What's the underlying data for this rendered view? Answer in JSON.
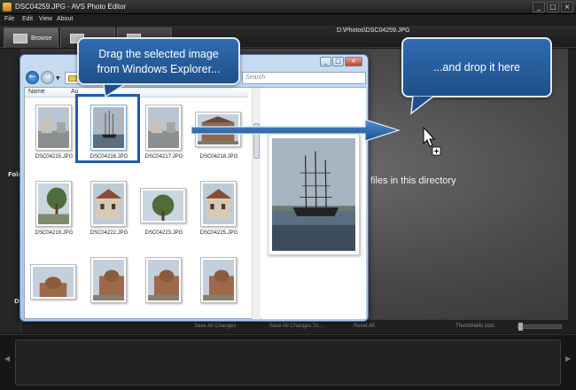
{
  "window": {
    "title": "DSC04259.JPG - AVS Photo Editor",
    "controls": [
      "_",
      "□",
      "×"
    ]
  },
  "menu": [
    "File",
    "Edit",
    "View",
    "About"
  ],
  "tabs": [
    {
      "label": "Browse",
      "active": true
    },
    {
      "label": "",
      "active": false
    },
    {
      "label": "",
      "active": false
    }
  ],
  "path": "D:\\Photos\\DSC04259.JPG",
  "left_panel": {
    "folders_label": "Fold",
    "bottom_label": "D"
  },
  "content": {
    "files_text": "files in this directory"
  },
  "status_bar": {
    "save_all": "Save All Changes",
    "save_all_to": "Save All Changes To...",
    "reset_all": "Reset All",
    "thumbnails_size": "Thumbnails size:",
    "thumbnails_size_level": 0
  },
  "explorer": {
    "address": "«",
    "search_placeholder": "Search",
    "columns": [
      "Name",
      "Au"
    ],
    "files": [
      {
        "name": "DSC04215.JPG",
        "orientation": "portrait",
        "scene": "street",
        "selected": false
      },
      {
        "name": "DSC04216.JPG",
        "orientation": "portrait",
        "scene": "ship",
        "selected": true
      },
      {
        "name": "DSC04217.JPG",
        "orientation": "portrait",
        "scene": "street",
        "selected": false
      },
      {
        "name": "DSC04218.JPG",
        "orientation": "landscape",
        "scene": "building",
        "selected": false
      },
      {
        "name": "DSC04219.JPG",
        "orientation": "portrait",
        "scene": "tree",
        "selected": false
      },
      {
        "name": "DSC04222.JPG",
        "orientation": "portrait",
        "scene": "house",
        "selected": false
      },
      {
        "name": "DSC04223.JPG",
        "orientation": "landscape",
        "scene": "tree",
        "selected": false
      },
      {
        "name": "DSC04225.JPG",
        "orientation": "portrait",
        "scene": "house",
        "selected": false
      },
      {
        "name": "",
        "orientation": "landscape",
        "scene": "church",
        "selected": false
      },
      {
        "name": "",
        "orientation": "portrait",
        "scene": "church",
        "selected": false
      },
      {
        "name": "",
        "orientation": "portrait",
        "scene": "church",
        "selected": false
      },
      {
        "name": "",
        "orientation": "portrait",
        "scene": "church",
        "selected": false
      }
    ]
  },
  "callouts": {
    "drag": [
      "Drag the selected image",
      "from Windows Explorer..."
    ],
    "drop": "...and drop it here"
  },
  "colors": {
    "callout_bg": "#2a62a3",
    "selection_border": "#1d5ea8"
  }
}
